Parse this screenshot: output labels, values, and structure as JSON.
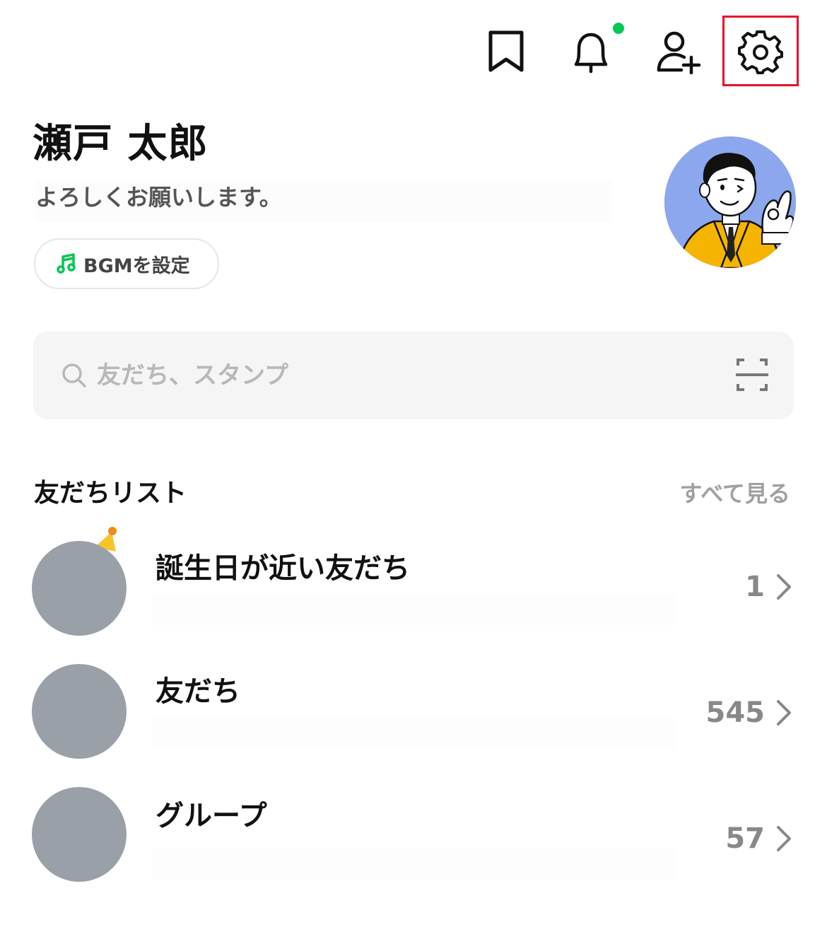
{
  "header": {
    "icons": [
      "bookmark-icon",
      "bell-icon",
      "add-friend-icon",
      "gear-icon"
    ],
    "notification_dot_color": "#06c755",
    "highlight_color": "#e5122c"
  },
  "profile": {
    "name": "瀬戸 太郎",
    "status_message": "よろしくお願いします。",
    "bgm_button_label": "BGMを設定",
    "bgm_icon_color": "#06c755",
    "avatar_bg": "#8da7ee"
  },
  "search": {
    "placeholder": "友だち、スタンプ"
  },
  "friends_section": {
    "title": "友だちリスト",
    "see_all_label": "すべて見る",
    "rows": [
      {
        "label": "誕生日が近い友だち",
        "count": "1"
      },
      {
        "label": "友だち",
        "count": "545"
      },
      {
        "label": "グループ",
        "count": "57"
      }
    ]
  }
}
